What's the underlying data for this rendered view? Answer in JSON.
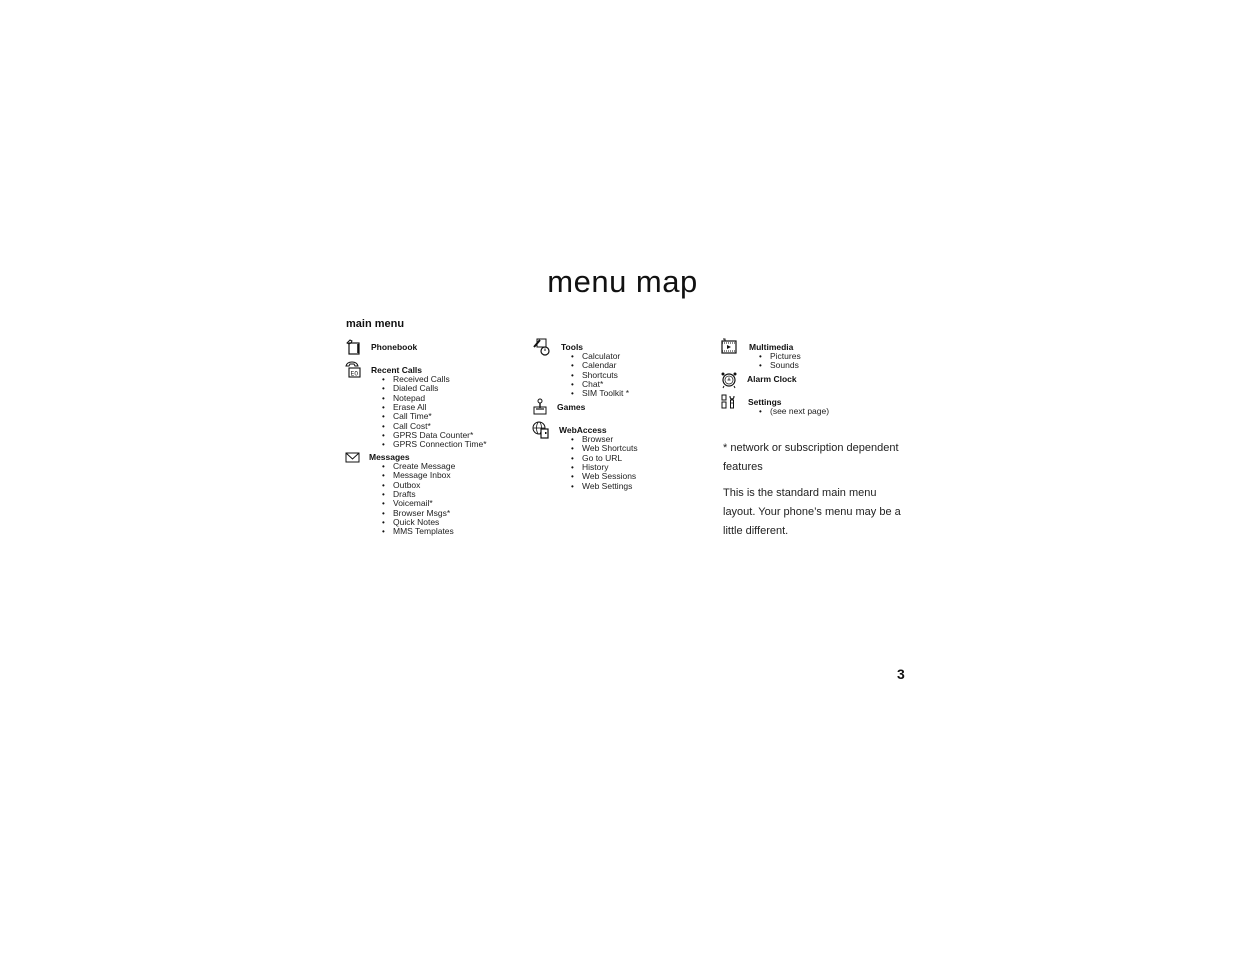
{
  "page": {
    "title": "menu map",
    "section_heading": "main menu",
    "page_number": "3"
  },
  "menu": {
    "column1": [
      {
        "icon": "phonebook-icon",
        "label": "Phonebook",
        "items": []
      },
      {
        "icon": "recent-calls-icon",
        "label": "Recent Calls",
        "items": [
          "Received Calls",
          "Dialed Calls",
          "Notepad",
          "Erase All",
          "Call Time*",
          "Call Cost*",
          "GPRS Data Counter*",
          "GPRS Connection Time*"
        ]
      },
      {
        "icon": "messages-icon",
        "label": "Messages",
        "items": [
          "Create Message",
          "Message Inbox",
          "Outbox",
          "Drafts",
          "Voicemail*",
          "Browser Msgs*",
          "Quick Notes",
          "MMS Templates"
        ]
      }
    ],
    "column2": [
      {
        "icon": "tools-icon",
        "label": "Tools",
        "items": [
          "Calculator",
          "Calendar",
          "Shortcuts",
          "Chat*",
          "SIM Toolkit *"
        ]
      },
      {
        "icon": "games-icon",
        "label": "Games",
        "items": []
      },
      {
        "icon": "webaccess-icon",
        "label": "WebAccess",
        "items": [
          "Browser",
          "Web Shortcuts",
          "Go to URL",
          "History",
          "Web Sessions",
          "Web Settings"
        ]
      }
    ],
    "column3": [
      {
        "icon": "multimedia-icon",
        "label": "Multimedia",
        "items": [
          "Pictures",
          "Sounds"
        ]
      },
      {
        "icon": "alarm-clock-icon",
        "label": "Alarm Clock",
        "items": []
      },
      {
        "icon": "settings-icon",
        "label": "Settings",
        "items": [
          "(see next page)"
        ]
      }
    ]
  },
  "notes": {
    "footnote": "* network or subscription dependent features",
    "description": "This is the standard main menu layout. Your phone’s menu may be a little different."
  }
}
